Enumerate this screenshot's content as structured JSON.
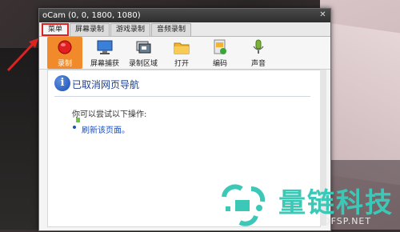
{
  "window": {
    "title": "oCam (0, 0, 1800, 1080)",
    "close": "✕"
  },
  "tabs": [
    "菜单",
    "屏幕录制",
    "游戏录制",
    "音频录制"
  ],
  "toolbar": [
    {
      "label": "录制",
      "icon": "record-icon"
    },
    {
      "label": "屏幕捕获",
      "icon": "monitor-icon"
    },
    {
      "label": "录制区域",
      "icon": "region-icon"
    },
    {
      "label": "打开",
      "icon": "folder-icon"
    },
    {
      "label": "编码",
      "icon": "codec-icon"
    },
    {
      "label": "声音",
      "icon": "microphone-icon"
    }
  ],
  "content": {
    "info_mark": "i",
    "heading": "已取消网页导航",
    "suggest": "你可以尝试以下操作:",
    "refresh_link": "刷新该页面。"
  },
  "watermark": {
    "text": "量链科技",
    "url": "QFSP.NET"
  },
  "colors": {
    "highlight": "#d22222",
    "record": "#f08a2a",
    "link": "#1a4fbf",
    "watermark": "#3bc8b6"
  }
}
